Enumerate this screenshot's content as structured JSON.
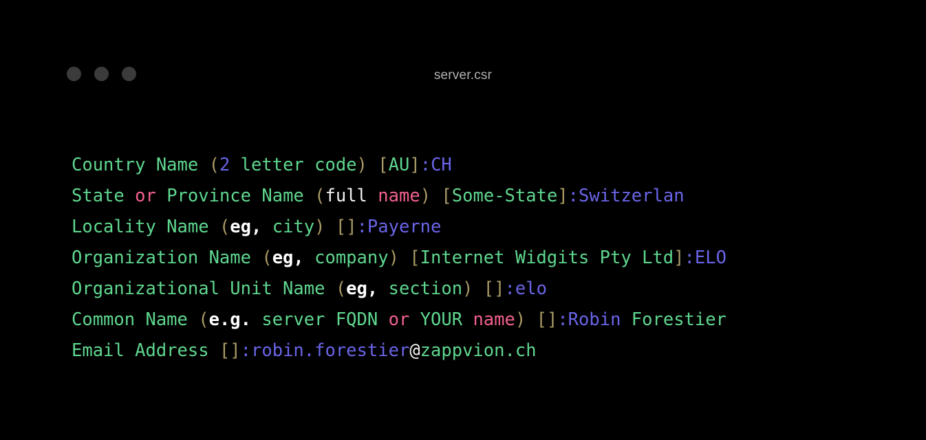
{
  "window": {
    "title": "server.csr",
    "traffic_lights": [
      {
        "name": "close",
        "color": "#3b3b3b"
      },
      {
        "name": "minimize",
        "color": "#3b3b3b"
      },
      {
        "name": "maximize",
        "color": "#3b3b3b"
      }
    ]
  },
  "theme": {
    "background": "#000000",
    "green": "#5fd78f",
    "purple": "#6a65e8",
    "pink": "#f2618d",
    "tan": "#a99a66",
    "white": "#f2f2f2",
    "title_text": "#b2b2b2",
    "dot": "#3b3b3b"
  },
  "terminal": {
    "lines": [
      {
        "id": "country-name",
        "plain": "Country Name (2 letter code) [AU]:CH",
        "tokens": [
          {
            "t": "Country Name ",
            "c": "green"
          },
          {
            "t": "(",
            "c": "tan"
          },
          {
            "t": "2",
            "c": "purple"
          },
          {
            "t": " letter code",
            "c": "green"
          },
          {
            "t": ")",
            "c": "tan"
          },
          {
            "t": " ",
            "c": "green"
          },
          {
            "t": "[",
            "c": "tan"
          },
          {
            "t": "AU",
            "c": "green"
          },
          {
            "t": "]",
            "c": "tan"
          },
          {
            "t": ":",
            "c": "purple"
          },
          {
            "t": "CH",
            "c": "purple"
          }
        ]
      },
      {
        "id": "state-or-province-name",
        "plain": "State or Province Name (full name) [Some-State]:Switzerlan",
        "tokens": [
          {
            "t": "State ",
            "c": "green"
          },
          {
            "t": "or",
            "c": "pink"
          },
          {
            "t": " Province Name ",
            "c": "green"
          },
          {
            "t": "(",
            "c": "tan"
          },
          {
            "t": "full",
            "c": "white"
          },
          {
            "t": " ",
            "c": "green"
          },
          {
            "t": "name",
            "c": "pink"
          },
          {
            "t": ")",
            "c": "tan"
          },
          {
            "t": " ",
            "c": "green"
          },
          {
            "t": "[",
            "c": "tan"
          },
          {
            "t": "Some-State",
            "c": "green"
          },
          {
            "t": "]",
            "c": "tan"
          },
          {
            "t": ":",
            "c": "purple"
          },
          {
            "t": "Switzerlan",
            "c": "purple"
          }
        ]
      },
      {
        "id": "locality-name",
        "plain": "Locality Name (eg, city) []:Payerne",
        "tokens": [
          {
            "t": "Locality Name ",
            "c": "green"
          },
          {
            "t": "(",
            "c": "tan"
          },
          {
            "t": "eg,",
            "c": "bold"
          },
          {
            "t": " city",
            "c": "green"
          },
          {
            "t": ")",
            "c": "tan"
          },
          {
            "t": " ",
            "c": "green"
          },
          {
            "t": "[]",
            "c": "tan"
          },
          {
            "t": ":",
            "c": "purple"
          },
          {
            "t": "Payerne",
            "c": "purple"
          }
        ]
      },
      {
        "id": "organization-name",
        "plain": "Organization Name (eg, company) [Internet Widgits Pty Ltd]:ELO",
        "tokens": [
          {
            "t": "Organization Name ",
            "c": "green"
          },
          {
            "t": "(",
            "c": "tan"
          },
          {
            "t": "eg,",
            "c": "bold"
          },
          {
            "t": " company",
            "c": "green"
          },
          {
            "t": ")",
            "c": "tan"
          },
          {
            "t": " ",
            "c": "green"
          },
          {
            "t": "[",
            "c": "tan"
          },
          {
            "t": "Internet Widgits Pty Ltd",
            "c": "green"
          },
          {
            "t": "]",
            "c": "tan"
          },
          {
            "t": ":",
            "c": "purple"
          },
          {
            "t": "ELO",
            "c": "purple"
          }
        ]
      },
      {
        "id": "organizational-unit-name",
        "plain": "Organizational Unit Name (eg, section) []:elo",
        "tokens": [
          {
            "t": "Organizational Unit Name ",
            "c": "green"
          },
          {
            "t": "(",
            "c": "tan"
          },
          {
            "t": "eg,",
            "c": "bold"
          },
          {
            "t": " section",
            "c": "green"
          },
          {
            "t": ")",
            "c": "tan"
          },
          {
            "t": " ",
            "c": "green"
          },
          {
            "t": "[]",
            "c": "tan"
          },
          {
            "t": ":",
            "c": "purple"
          },
          {
            "t": "elo",
            "c": "purple"
          }
        ]
      },
      {
        "id": "common-name",
        "plain": "Common Name (e.g. server FQDN or YOUR name) []:Robin Forestier",
        "tokens": [
          {
            "t": "Common Name ",
            "c": "green"
          },
          {
            "t": "(",
            "c": "tan"
          },
          {
            "t": "e.g.",
            "c": "bold"
          },
          {
            "t": " server FQDN ",
            "c": "green"
          },
          {
            "t": "or",
            "c": "pink"
          },
          {
            "t": " YOUR ",
            "c": "green"
          },
          {
            "t": "name",
            "c": "pink"
          },
          {
            "t": ")",
            "c": "tan"
          },
          {
            "t": " ",
            "c": "green"
          },
          {
            "t": "[]",
            "c": "tan"
          },
          {
            "t": ":",
            "c": "purple"
          },
          {
            "t": "Robin",
            "c": "purple"
          },
          {
            "t": " Forestier",
            "c": "green"
          }
        ]
      },
      {
        "id": "email-address",
        "plain": "Email Address []:robin.forestier@zappvion.ch",
        "tokens": [
          {
            "t": "Email Address ",
            "c": "green"
          },
          {
            "t": "[]",
            "c": "tan"
          },
          {
            "t": ":",
            "c": "purple"
          },
          {
            "t": "robin.forestier",
            "c": "purple"
          },
          {
            "t": "@",
            "c": "white"
          },
          {
            "t": "zappvion.ch",
            "c": "green"
          }
        ]
      }
    ]
  }
}
